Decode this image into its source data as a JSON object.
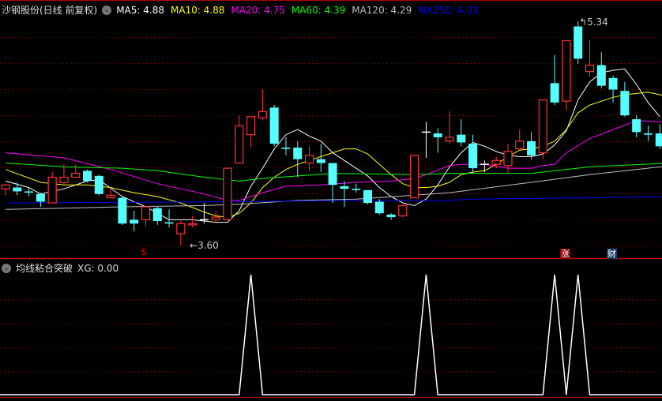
{
  "header": {
    "title": "沙钢股份(日线 前复权)",
    "ma": [
      {
        "label": "MA5: 4.88",
        "color": "#ffffff"
      },
      {
        "label": "MA10: 4.88",
        "color": "#ffff00"
      },
      {
        "label": "MA20: 4.75",
        "color": "#ff00ff"
      },
      {
        "label": "MA60: 4.39",
        "color": "#00ff00"
      },
      {
        "label": "MA120: 4.29",
        "color": "#c0c0c0"
      },
      {
        "label": "MA250: 4.03",
        "color": "#0000ff"
      }
    ]
  },
  "indicator": {
    "title": "均线粘合突破",
    "value_label": "XG: 0.00"
  },
  "annotations": {
    "low_label": "3.60",
    "high_label": "5.34",
    "s_marker": "S",
    "badge_zhang": "涨",
    "badge_cai": "财"
  },
  "colors": {
    "up": "#ff3232",
    "down": "#54ffff",
    "doji": "#ffffff",
    "grid": "#8b0000"
  },
  "chart_data": [
    {
      "type": "candlestick",
      "title": "沙钢股份 日线 前复权",
      "ylim": [
        3.6,
        5.34
      ],
      "grid": true,
      "ohlc": [
        [
          4.04,
          4.07,
          4.08,
          3.99
        ],
        [
          4.05,
          4.02,
          4.09,
          3.99
        ],
        [
          4.02,
          4.01,
          4.05,
          3.98
        ],
        [
          4.0,
          3.94,
          4.01,
          3.9
        ],
        [
          3.93,
          4.13,
          4.17,
          3.93
        ],
        [
          4.09,
          4.13,
          4.23,
          4.07
        ],
        [
          4.13,
          4.16,
          4.23,
          4.13
        ],
        [
          4.18,
          4.1,
          4.19,
          4.09
        ],
        [
          4.14,
          4.0,
          4.15,
          3.99
        ],
        [
          3.97,
          3.99,
          4.05,
          3.97
        ],
        [
          3.97,
          3.77,
          3.98,
          3.76
        ],
        [
          3.8,
          3.77,
          3.87,
          3.71
        ],
        [
          3.8,
          3.9,
          3.9,
          3.75
        ],
        [
          3.89,
          3.79,
          3.9,
          3.76
        ],
        [
          3.78,
          3.77,
          3.88,
          3.74
        ],
        [
          3.69,
          3.77,
          3.79,
          3.6
        ],
        [
          3.76,
          3.77,
          3.83,
          3.74
        ],
        [
          3.8,
          3.8,
          3.93,
          3.77
        ],
        [
          3.8,
          3.82,
          3.87,
          3.77
        ],
        [
          3.8,
          4.2,
          4.2,
          3.8
        ],
        [
          4.24,
          4.53,
          4.61,
          4.24
        ],
        [
          4.46,
          4.6,
          4.6,
          4.36
        ],
        [
          4.59,
          4.64,
          4.81,
          4.57
        ],
        [
          4.67,
          4.39,
          4.69,
          4.37
        ],
        [
          4.36,
          4.35,
          4.44,
          4.3
        ],
        [
          4.36,
          4.27,
          4.41,
          4.13
        ],
        [
          4.24,
          4.3,
          4.37,
          4.18
        ],
        [
          4.27,
          4.24,
          4.39,
          4.17
        ],
        [
          4.24,
          4.07,
          4.24,
          3.93
        ],
        [
          4.06,
          4.04,
          4.1,
          3.9
        ],
        [
          4.04,
          4.03,
          4.08,
          4.01
        ],
        [
          4.03,
          3.93,
          4.03,
          3.92
        ],
        [
          3.94,
          3.85,
          3.96,
          3.84
        ],
        [
          3.84,
          3.82,
          3.85,
          3.8
        ],
        [
          3.83,
          3.91,
          3.91,
          3.82
        ],
        [
          3.97,
          4.3,
          4.3,
          3.97
        ],
        [
          4.48,
          4.48,
          4.56,
          4.28
        ],
        [
          4.47,
          4.44,
          4.51,
          4.32
        ],
        [
          4.41,
          4.44,
          4.64,
          4.39
        ],
        [
          4.46,
          4.4,
          4.58,
          4.37
        ],
        [
          4.39,
          4.2,
          4.46,
          4.16
        ],
        [
          4.23,
          4.23,
          4.26,
          4.17
        ],
        [
          4.23,
          4.26,
          4.29,
          4.2
        ],
        [
          4.22,
          4.33,
          4.39,
          4.16
        ],
        [
          4.35,
          4.41,
          4.5,
          4.35
        ],
        [
          4.41,
          4.3,
          4.48,
          4.27
        ],
        [
          4.32,
          4.73,
          4.73,
          4.27
        ],
        [
          4.86,
          4.71,
          5.08,
          4.69
        ],
        [
          4.72,
          5.19,
          5.19,
          4.65
        ],
        [
          5.3,
          5.05,
          5.34,
          5.01
        ],
        [
          4.95,
          5.0,
          5.19,
          4.91
        ],
        [
          5.0,
          4.84,
          5.1,
          4.82
        ],
        [
          4.9,
          4.81,
          4.92,
          4.71
        ],
        [
          4.8,
          4.61,
          4.87,
          4.6
        ],
        [
          4.58,
          4.48,
          4.61,
          4.44
        ],
        [
          4.47,
          4.46,
          4.53,
          4.41
        ],
        [
          4.47,
          4.37,
          4.54,
          4.35
        ]
      ],
      "ma_series": [
        {
          "name": "MA5",
          "color": "#ffffff",
          "points": [
            [
              0,
              4.1
            ],
            [
              2,
              4.05
            ],
            [
              3,
              4.0
            ],
            [
              5,
              4.04
            ],
            [
              7,
              4.1
            ],
            [
              8,
              4.11
            ],
            [
              10,
              3.98
            ],
            [
              12,
              3.9
            ],
            [
              14,
              3.8
            ],
            [
              16,
              3.8
            ],
            [
              18,
              3.78
            ],
            [
              19,
              3.78
            ],
            [
              20,
              3.87
            ],
            [
              21,
              4.06
            ],
            [
              22,
              4.2
            ],
            [
              23,
              4.35
            ],
            [
              24,
              4.46
            ],
            [
              25,
              4.5
            ],
            [
              26,
              4.45
            ],
            [
              27,
              4.41
            ],
            [
              28,
              4.32
            ],
            [
              29,
              4.26
            ],
            [
              30,
              4.2
            ],
            [
              31,
              4.14
            ],
            [
              32,
              4.05
            ],
            [
              33,
              3.98
            ],
            [
              34,
              3.93
            ],
            [
              35,
              3.91
            ],
            [
              36,
              3.96
            ],
            [
              37,
              4.07
            ],
            [
              38,
              4.21
            ],
            [
              39,
              4.32
            ],
            [
              40,
              4.4
            ],
            [
              41,
              4.37
            ],
            [
              42,
              4.33
            ],
            [
              43,
              4.3
            ],
            [
              44,
              4.29
            ],
            [
              45,
              4.29
            ],
            [
              46,
              4.31
            ],
            [
              47,
              4.38
            ],
            [
              48,
              4.49
            ],
            [
              49,
              4.73
            ],
            [
              50,
              4.87
            ],
            [
              51,
              4.94
            ],
            [
              52,
              4.96
            ],
            [
              53,
              4.97
            ],
            [
              54,
              4.85
            ],
            [
              55,
              4.71
            ],
            [
              56,
              4.6
            ]
          ]
        },
        {
          "name": "MA10",
          "color": "#ffff00",
          "points": [
            [
              0,
              4.19
            ],
            [
              3,
              4.09
            ],
            [
              5,
              4.07
            ],
            [
              7,
              4.07
            ],
            [
              9,
              4.05
            ],
            [
              11,
              4.01
            ],
            [
              13,
              3.98
            ],
            [
              15,
              3.93
            ],
            [
              17,
              3.86
            ],
            [
              18,
              3.83
            ],
            [
              19,
              3.82
            ],
            [
              20,
              3.85
            ],
            [
              21,
              3.93
            ],
            [
              22,
              4.05
            ],
            [
              23,
              4.13
            ],
            [
              24,
              4.19
            ],
            [
              25,
              4.23
            ],
            [
              26,
              4.26
            ],
            [
              27,
              4.29
            ],
            [
              28,
              4.32
            ],
            [
              29,
              4.35
            ],
            [
              30,
              4.35
            ],
            [
              31,
              4.31
            ],
            [
              32,
              4.23
            ],
            [
              33,
              4.15
            ],
            [
              34,
              4.08
            ],
            [
              35,
              4.05
            ],
            [
              36,
              4.05
            ],
            [
              37,
              4.06
            ],
            [
              38,
              4.09
            ],
            [
              39,
              4.15
            ],
            [
              40,
              4.17
            ],
            [
              41,
              4.18
            ],
            [
              42,
              4.23
            ],
            [
              43,
              4.29
            ],
            [
              44,
              4.34
            ],
            [
              45,
              4.35
            ],
            [
              46,
              4.37
            ],
            [
              47,
              4.41
            ],
            [
              48,
              4.5
            ],
            [
              49,
              4.63
            ],
            [
              50,
              4.69
            ],
            [
              51,
              4.72
            ],
            [
              52,
              4.75
            ],
            [
              53,
              4.77
            ],
            [
              54,
              4.78
            ],
            [
              55,
              4.79
            ],
            [
              56,
              4.77
            ],
            [
              57,
              4.75
            ]
          ]
        },
        {
          "name": "MA20",
          "color": "#ff00ff",
          "points": [
            [
              0,
              4.32
            ],
            [
              5,
              4.28
            ],
            [
              9,
              4.19
            ],
            [
              13,
              4.08
            ],
            [
              17,
              4.0
            ],
            [
              19,
              3.95
            ],
            [
              20,
              3.95
            ],
            [
              22,
              4.01
            ],
            [
              24,
              4.06
            ],
            [
              27,
              4.07
            ],
            [
              30,
              4.09
            ],
            [
              33,
              4.1
            ],
            [
              35,
              4.12
            ],
            [
              36,
              4.15
            ],
            [
              38,
              4.22
            ],
            [
              39,
              4.23
            ],
            [
              41,
              4.23
            ],
            [
              43,
              4.2
            ],
            [
              45,
              4.2
            ],
            [
              46,
              4.22
            ],
            [
              47,
              4.23
            ],
            [
              48,
              4.32
            ],
            [
              50,
              4.43
            ],
            [
              52,
              4.5
            ],
            [
              54,
              4.57
            ],
            [
              56,
              4.56
            ],
            [
              57,
              4.56
            ]
          ]
        },
        {
          "name": "MA60",
          "color": "#00ff00",
          "points": [
            [
              0,
              4.24
            ],
            [
              5,
              4.21
            ],
            [
              10,
              4.2
            ],
            [
              13,
              4.18
            ],
            [
              17,
              4.13
            ],
            [
              20,
              4.1
            ],
            [
              22,
              4.12
            ],
            [
              25,
              4.14
            ],
            [
              28,
              4.16
            ],
            [
              35,
              4.15
            ],
            [
              38,
              4.16
            ],
            [
              45,
              4.16
            ],
            [
              50,
              4.21
            ],
            [
              57,
              4.24
            ]
          ]
        },
        {
          "name": "MA120",
          "color": "#c0c0c0",
          "points": [
            [
              0,
              3.88
            ],
            [
              5,
              3.89
            ],
            [
              10,
              3.9
            ],
            [
              17,
              3.91
            ],
            [
              20,
              3.92
            ],
            [
              25,
              3.95
            ],
            [
              30,
              3.96
            ],
            [
              35,
              3.99
            ],
            [
              38,
              4.01
            ],
            [
              45,
              4.09
            ],
            [
              50,
              4.15
            ],
            [
              57,
              4.22
            ]
          ]
        },
        {
          "name": "MA250",
          "color": "#0000ff",
          "points": [
            [
              0,
              3.93
            ],
            [
              20,
              3.94
            ],
            [
              30,
              3.95
            ],
            [
              38,
              3.95
            ],
            [
              40,
              3.96
            ],
            [
              50,
              3.97
            ],
            [
              57,
              3.98
            ]
          ]
        }
      ],
      "xg_signal": {
        "name": "XG",
        "ylim": [
          0,
          1
        ],
        "signal_indices": [
          21,
          36,
          47,
          49
        ]
      }
    }
  ]
}
